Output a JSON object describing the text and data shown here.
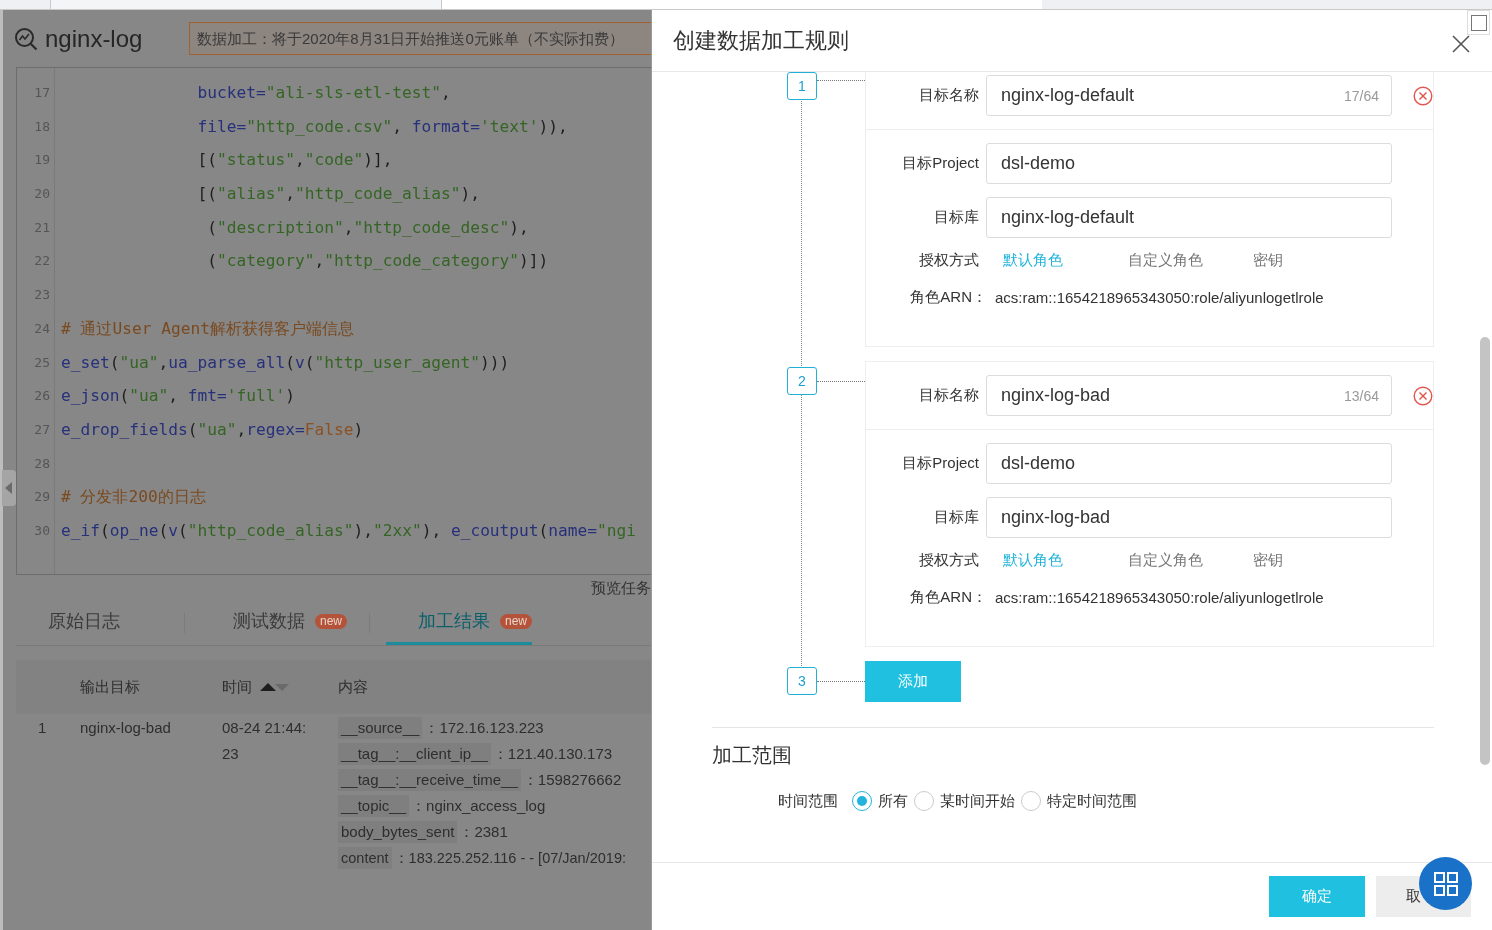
{
  "app": {
    "title": "nginx-log",
    "notice": "数据加工：将于2020年8月31日开始推送0元账单（不实际扣费）"
  },
  "editor": {
    "lines": [
      {
        "number": "17",
        "tokens": [
          {
            "kind": "kw",
            "text": "              bucket="
          },
          {
            "kind": "str",
            "text": "\"ali-sls-etl-test\""
          },
          {
            "kind": "plain",
            "text": ","
          }
        ]
      },
      {
        "number": "18",
        "tokens": [
          {
            "kind": "kw",
            "text": "              file="
          },
          {
            "kind": "str",
            "text": "\"http_code.csv\""
          },
          {
            "kind": "plain",
            "text": ", "
          },
          {
            "kind": "kw",
            "text": "format="
          },
          {
            "kind": "str",
            "text": "'text'"
          },
          {
            "kind": "plain",
            "text": ")),"
          }
        ]
      },
      {
        "number": "19",
        "tokens": [
          {
            "kind": "plain",
            "text": "              [("
          },
          {
            "kind": "str",
            "text": "\"status\""
          },
          {
            "kind": "plain",
            "text": ","
          },
          {
            "kind": "str",
            "text": "\"code\""
          },
          {
            "kind": "plain",
            "text": ")],"
          }
        ]
      },
      {
        "number": "20",
        "tokens": [
          {
            "kind": "plain",
            "text": "              [("
          },
          {
            "kind": "str",
            "text": "\"alias\""
          },
          {
            "kind": "plain",
            "text": ","
          },
          {
            "kind": "str",
            "text": "\"http_code_alias\""
          },
          {
            "kind": "plain",
            "text": "),"
          }
        ]
      },
      {
        "number": "21",
        "tokens": [
          {
            "kind": "plain",
            "text": "               ("
          },
          {
            "kind": "str",
            "text": "\"description\""
          },
          {
            "kind": "plain",
            "text": ","
          },
          {
            "kind": "str",
            "text": "\"http_code_desc\""
          },
          {
            "kind": "plain",
            "text": "),"
          }
        ]
      },
      {
        "number": "22",
        "tokens": [
          {
            "kind": "plain",
            "text": "               ("
          },
          {
            "kind": "str",
            "text": "\"category\""
          },
          {
            "kind": "plain",
            "text": ","
          },
          {
            "kind": "str",
            "text": "\"http_code_category\""
          },
          {
            "kind": "plain",
            "text": ")])"
          }
        ]
      },
      {
        "number": "23"
      },
      {
        "number": "24",
        "tokens": [
          {
            "kind": "comment",
            "text": "# 通过User Agent解析获得客户端信息"
          }
        ]
      },
      {
        "number": "25",
        "tokens": [
          {
            "kind": "kw",
            "text": "e_set"
          },
          {
            "kind": "plain",
            "text": "("
          },
          {
            "kind": "str",
            "text": "\"ua\""
          },
          {
            "kind": "plain",
            "text": ","
          },
          {
            "kind": "kw",
            "text": "ua_parse_all"
          },
          {
            "kind": "plain",
            "text": "("
          },
          {
            "kind": "kw",
            "text": "v"
          },
          {
            "kind": "plain",
            "text": "("
          },
          {
            "kind": "str",
            "text": "\"http_user_agent\""
          },
          {
            "kind": "plain",
            "text": ")))"
          }
        ]
      },
      {
        "number": "26",
        "tokens": [
          {
            "kind": "kw",
            "text": "e_json"
          },
          {
            "kind": "plain",
            "text": "("
          },
          {
            "kind": "str",
            "text": "\"ua\""
          },
          {
            "kind": "plain",
            "text": ", "
          },
          {
            "kind": "kw",
            "text": "fmt="
          },
          {
            "kind": "str",
            "text": "'full'"
          },
          {
            "kind": "plain",
            "text": ")"
          }
        ]
      },
      {
        "number": "27",
        "tokens": [
          {
            "kind": "kw",
            "text": "e_drop_fields"
          },
          {
            "kind": "plain",
            "text": "("
          },
          {
            "kind": "str",
            "text": "\"ua\""
          },
          {
            "kind": "plain",
            "text": ","
          },
          {
            "kind": "kw",
            "text": "regex="
          },
          {
            "kind": "bool",
            "text": "False"
          },
          {
            "kind": "plain",
            "text": ")"
          }
        ]
      },
      {
        "number": "28"
      },
      {
        "number": "29",
        "tokens": [
          {
            "kind": "comment",
            "text": "# 分发非200的日志"
          }
        ]
      },
      {
        "number": "30",
        "tokens": [
          {
            "kind": "kw",
            "text": "e_if"
          },
          {
            "kind": "plain",
            "text": "("
          },
          {
            "kind": "kw",
            "text": "op_ne"
          },
          {
            "kind": "plain",
            "text": "("
          },
          {
            "kind": "kw",
            "text": "v"
          },
          {
            "kind": "plain",
            "text": "("
          },
          {
            "kind": "str",
            "text": "\"http_code_alias\""
          },
          {
            "kind": "plain",
            "text": "),"
          },
          {
            "kind": "str",
            "text": "\"2xx\""
          },
          {
            "kind": "plain",
            "text": "), "
          },
          {
            "kind": "kw",
            "text": "e_coutput"
          },
          {
            "kind": "plain",
            "text": "("
          },
          {
            "kind": "kw",
            "text": "name="
          },
          {
            "kind": "str",
            "text": "\"ngi"
          }
        ]
      }
    ]
  },
  "preview_label": "预览任务",
  "tabs": [
    {
      "label": "原始日志",
      "selected": false
    },
    {
      "label": "测试数据",
      "badge": "new",
      "selected": false
    },
    {
      "label": "加工结果",
      "badge": "new",
      "selected": true
    }
  ],
  "table": {
    "columns": [
      {
        "label": "输出目标"
      },
      {
        "label": "时间",
        "sort_ascending": true
      },
      {
        "label": "内容"
      }
    ],
    "rows": [
      {
        "index": "1",
        "target": "nginx-log-bad",
        "time": "08-24 21:44:23",
        "fields": [
          {
            "key": "__source__",
            "value": "：172.16.123.223"
          },
          {
            "key": "__tag__:__client_ip__",
            "value": "：121.40.130.173"
          },
          {
            "key": "__tag__:__receive_time__",
            "value": "：1598276662"
          },
          {
            "key": "__topic__",
            "value": "：nginx_access_log"
          },
          {
            "key": "body_bytes_sent",
            "value": "：2381"
          },
          {
            "key": "content",
            "value": "：183.225.252.116 - - [07/Jan/2019:"
          }
        ]
      }
    ]
  },
  "drawer": {
    "title": "创建数据加工规则",
    "targets": [
      {
        "step": "1",
        "name_label": "目标名称",
        "name": "nginx-log-default",
        "count": "17/64",
        "project_label": "目标Project",
        "project": "dsl-demo",
        "store_label": "目标库",
        "store": "nginx-log-default",
        "auth_label": "授权方式",
        "auth_options": [
          {
            "label": "默认角色",
            "selected": true
          },
          {
            "label": "自定义角色",
            "selected": false
          },
          {
            "label": "密钥",
            "selected": false
          }
        ],
        "arn_label": "角色ARN：",
        "arn": "acs:ram::1654218965343050:role/aliyunlogetlrole"
      },
      {
        "step": "2",
        "name_label": "目标名称",
        "name": "nginx-log-bad",
        "count": "13/64",
        "project_label": "目标Project",
        "project": "dsl-demo",
        "store_label": "目标库",
        "store": "nginx-log-bad",
        "auth_label": "授权方式",
        "auth_options": [
          {
            "label": "默认角色",
            "selected": true
          },
          {
            "label": "自定义角色",
            "selected": false
          },
          {
            "label": "密钥",
            "selected": false
          }
        ],
        "arn_label": "角色ARN：",
        "arn": "acs:ram::1654218965343050:role/aliyunlogetlrole"
      }
    ],
    "add_step": {
      "step": "3",
      "button": "添加"
    },
    "range": {
      "title": "加工范围",
      "label": "时间范围",
      "options": [
        {
          "label": "所有",
          "selected": true
        },
        {
          "label": "某时间开始",
          "selected": false
        },
        {
          "label": "特定时间范围",
          "selected": false
        }
      ]
    },
    "footer": {
      "confirm": "确定",
      "cancel": "取"
    }
  }
}
